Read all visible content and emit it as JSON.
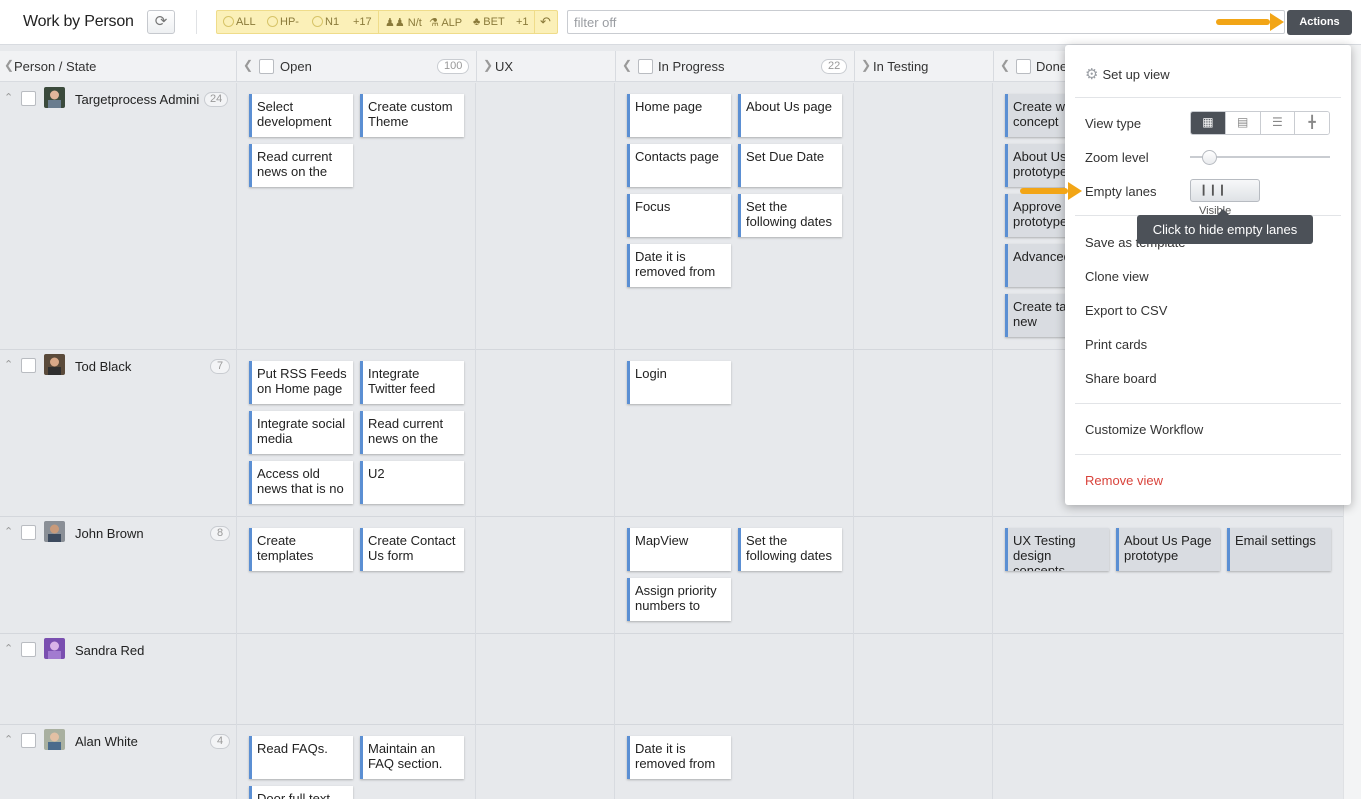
{
  "header": {
    "title": "Work by Person",
    "refresh_icon": "refresh-icon",
    "filters": {
      "all": "ALL",
      "hp": "HP-",
      "n1": "N1",
      "more": "+17",
      "nt": "N/t",
      "alp": "ALP",
      "bet": "BET",
      "plus1": "+1"
    },
    "filter_placeholder": "filter off",
    "actions_label": "Actions"
  },
  "columns": [
    {
      "label": "Person / State",
      "count": ""
    },
    {
      "label": "Open",
      "count": "100"
    },
    {
      "label": "UX",
      "count": ""
    },
    {
      "label": "In Progress",
      "count": "22"
    },
    {
      "label": "In Testing",
      "count": ""
    },
    {
      "label": "Done",
      "count": ""
    }
  ],
  "lanes": [
    {
      "name": "Targetprocess Admini",
      "count": "24",
      "open": [
        "Select development",
        "Create custom Theme",
        "Read current news on the"
      ],
      "in_progress": [
        "Home page",
        "About Us page",
        "Contacts page",
        "Set Due Date",
        "Focus",
        "Set the following dates",
        "Date it is removed from"
      ],
      "done": [
        "Create web concept",
        "About Us prototype",
        "Approve prototype",
        "Advanced API",
        "Create ta from new"
      ]
    },
    {
      "name": "Tod Black",
      "count": "7",
      "open": [
        "Put RSS Feeds on Home page",
        "Integrate Twitter feed",
        "Integrate social media",
        "Read current news on the",
        "Access old news that is no",
        "U2"
      ],
      "in_progress": [
        "Login"
      ],
      "done": []
    },
    {
      "name": "John Brown",
      "count": "8",
      "open": [
        "Create templates",
        "Create Contact Us form"
      ],
      "in_progress": [
        "MapView",
        "Set the following dates",
        "Assign priority numbers to"
      ],
      "done": [
        "UX Testing design concepts",
        "About Us Page prototype",
        "Email settings"
      ]
    },
    {
      "name": "Sandra Red",
      "count": "",
      "open": [],
      "in_progress": [],
      "done": []
    },
    {
      "name": "Alan White",
      "count": "4",
      "open": [
        "Read FAQs.",
        "Maintain an FAQ section.",
        "Door full text"
      ],
      "in_progress": [
        "Date it is removed from"
      ],
      "done": []
    }
  ],
  "menu": {
    "setup": "Set up view",
    "view_type": "View type",
    "zoom": "Zoom level",
    "zoom_level": 0.15,
    "empty_lanes": "Empty lanes",
    "visible": "Visible",
    "save_template": "Save as template",
    "clone": "Clone view",
    "export": "Export to CSV",
    "print": "Print cards",
    "share": "Share board",
    "customize": "Customize Workflow",
    "remove": "Remove view"
  },
  "tooltip": "Click to hide empty lanes",
  "colors": {
    "accent": "#4c5158",
    "arrow": "#f2a516",
    "card_border": "#5b8fd3",
    "remove": "#d9433b",
    "filter_bg": "#fbf0b8"
  }
}
